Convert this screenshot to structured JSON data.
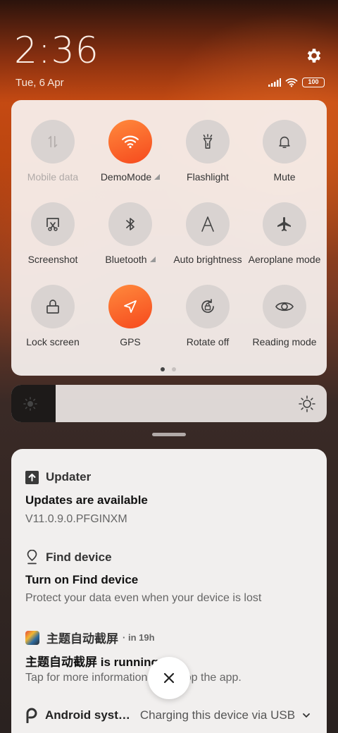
{
  "status": {
    "time": "2:36",
    "date": "Tue, 6 Apr",
    "battery": "100"
  },
  "quick_settings": {
    "tiles": [
      {
        "label": "Mobile data",
        "icon": "mobile-data-icon",
        "active": false,
        "disabled": true
      },
      {
        "label": "DemoMode",
        "icon": "wifi-icon",
        "active": true,
        "expand": true
      },
      {
        "label": "Flashlight",
        "icon": "flashlight-icon",
        "active": false
      },
      {
        "label": "Mute",
        "icon": "bell-icon",
        "active": false
      },
      {
        "label": "Screenshot",
        "icon": "screenshot-icon",
        "active": false
      },
      {
        "label": "Bluetooth",
        "icon": "bluetooth-icon",
        "active": false,
        "expand": true
      },
      {
        "label": "Auto brightness",
        "icon": "auto-brightness-icon",
        "active": false
      },
      {
        "label": "Aeroplane mode",
        "icon": "airplane-icon",
        "active": false
      },
      {
        "label": "Lock screen",
        "icon": "lock-icon",
        "active": false
      },
      {
        "label": "GPS",
        "icon": "location-arrow-icon",
        "active": true
      },
      {
        "label": "Rotate off",
        "icon": "rotate-lock-icon",
        "active": false
      },
      {
        "label": "Reading mode",
        "icon": "eye-icon",
        "active": false
      }
    ],
    "page_indicator": {
      "current": 1,
      "total": 2
    }
  },
  "brightness": {
    "level": 0.14
  },
  "notifications": [
    {
      "app": "Updater",
      "icon": "upload-arrow-icon",
      "title": "Updates are available",
      "text": "V11.0.9.0.PFGINXM"
    },
    {
      "app": "Find device",
      "icon": "location-pin-icon",
      "title": "Turn on Find device",
      "text": "Protect your data even when your device is lost"
    },
    {
      "app": "主题自动截屏",
      "time": "in 19h",
      "title": "主题自动截屏 is running",
      "text": "Tap for more information or to stop the app."
    },
    {
      "app": "Android syst…",
      "text": "Charging this device via USB"
    }
  ],
  "colors": {
    "accent": "#f6491d",
    "accent_light": "#ff8a3d",
    "panel": "#f8f2f0"
  }
}
